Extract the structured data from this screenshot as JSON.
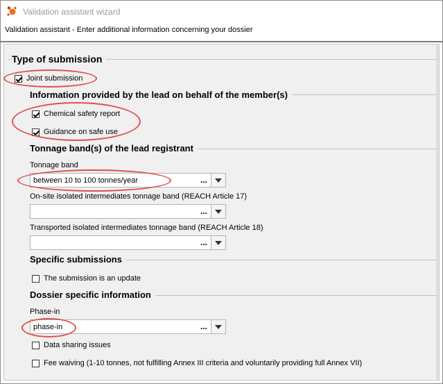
{
  "window": {
    "title": "Validation assistant wizard",
    "subtitle": "Validation assistant - Enter additional information concerning your dossier",
    "icon": "app-logo-icon"
  },
  "type_of_submission": {
    "heading": "Type of submission",
    "joint_submission": {
      "label": "Joint submission",
      "checked": true
    }
  },
  "lead_info": {
    "heading": "Information provided by the lead on behalf of the member(s)",
    "chemical_safety_report": {
      "label": "Chemical safety report",
      "checked": true
    },
    "guidance_safe_use": {
      "label": "Guidance on safe use",
      "checked": true
    }
  },
  "tonnage": {
    "heading": "Tonnage band(s) of the lead registrant",
    "band_label": "Tonnage band",
    "band_value": "between 10 to 100 tonnes/year",
    "onsite_label": "On-site isolated intermediates tonnage band (REACH Article 17)",
    "onsite_value": "",
    "transported_label": "Transported isolated intermediates tonnage band (REACH Article 18)",
    "transported_value": "",
    "dots": "..."
  },
  "specific": {
    "heading": "Specific submissions",
    "update": {
      "label": "The submission is an update",
      "checked": false
    }
  },
  "dossier": {
    "heading": "Dossier specific information",
    "phase_label": "Phase-in",
    "phase_value": "phase-in",
    "data_sharing": {
      "label": "Data sharing issues",
      "checked": false
    },
    "fee_waiving": {
      "label": "Fee waiving (1-10 tonnes, not fulfilling Annex III criteria and voluntarily providing full Annex VII)",
      "checked": false
    }
  },
  "colors": {
    "highlight": "#e05050",
    "background": "#f0f0f0"
  }
}
